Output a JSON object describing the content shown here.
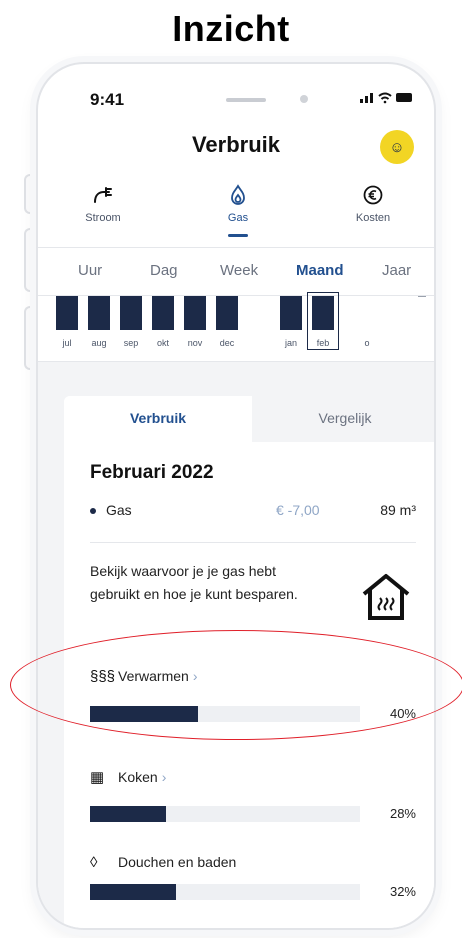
{
  "heading": "Inzicht",
  "status": {
    "time": "9:41",
    "icons": "▪▪▪ ◔ ▬"
  },
  "appbar": {
    "title": "Verbruik",
    "avatar_glyph": "☺"
  },
  "energy_tabs": [
    {
      "label": "Stroom",
      "icon": "plug-icon",
      "glyph": "⌁"
    },
    {
      "label": "Gas",
      "icon": "flame-icon",
      "glyph": "♢",
      "active": true
    },
    {
      "label": "Kosten",
      "icon": "euro-icon",
      "glyph": "€"
    }
  ],
  "period_tabs": [
    "Uur",
    "Dag",
    "Week",
    "Maand",
    "Jaar"
  ],
  "period_selected": "Maand",
  "chart_data": {
    "type": "bar",
    "categories": [
      "jul",
      "aug",
      "sep",
      "okt",
      "nov",
      "dec",
      "jan",
      "feb",
      "o"
    ],
    "selected": "feb"
  },
  "detail_tabs": {
    "active": "Verbruik",
    "inactive": "Vergelijk"
  },
  "month_title": "Februari 2022",
  "gas_row": {
    "label": "Gas",
    "cost": "€ -7,00",
    "volume": "89 m³"
  },
  "info_text": "Bekijk waarvoor je je gas hebt gebruikt en hoe je kunt besparen.",
  "categories": [
    {
      "label": "Verwarmen",
      "icon": "heating-icon",
      "glyph": "§§§",
      "percent_text": "40%",
      "fill": 0.4,
      "has_link": true
    },
    {
      "label": "Koken",
      "icon": "stove-icon",
      "glyph": "▦",
      "percent_text": "28%",
      "fill": 0.28,
      "has_link": true
    },
    {
      "label": "Douchen en baden",
      "icon": "shower-drop-icon",
      "glyph": "◊",
      "percent_text": "32%",
      "fill": 0.32,
      "has_link": false
    }
  ],
  "chevron": "›",
  "colors": {
    "navy": "#1c2a48",
    "accent_blue": "#22508f",
    "avatar_yellow": "#f2d524",
    "highlight_red": "#e0202a"
  }
}
